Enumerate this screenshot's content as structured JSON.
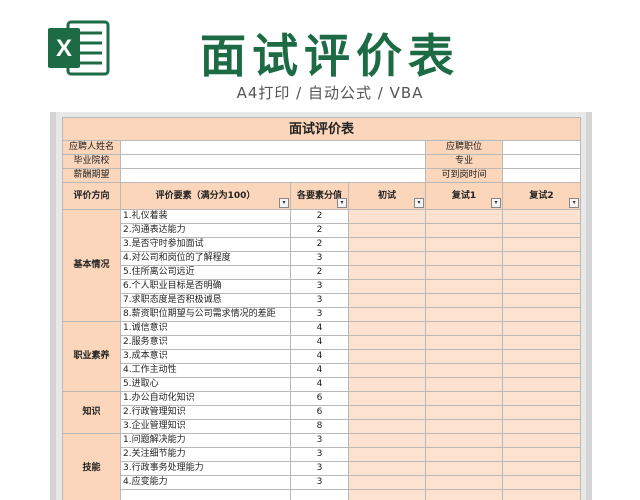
{
  "header": {
    "title": "面试评价表",
    "subtitle": "A4打印 / 自动公式 / VBA",
    "logo_icon": "excel-logo-icon",
    "logo_letter": "X",
    "accent": "#1c6b45"
  },
  "sheet": {
    "title": "面试评价表",
    "info_rows": [
      {
        "label1": "应聘人姓名",
        "label2": "应聘职位"
      },
      {
        "label1": "毕业院校",
        "label2": "专业"
      },
      {
        "label1": "薪酬期望",
        "label2": "可到岗时间"
      }
    ],
    "columns": [
      "评价方向",
      "评价要素（满分为100）",
      "各要素分值",
      "初试",
      "复试1",
      "复试2"
    ],
    "dropdown_glyph": "▾",
    "categories": [
      {
        "name": "基本情况",
        "items": [
          {
            "text": "1.礼仪着装",
            "score": "2"
          },
          {
            "text": "2.沟通表达能力",
            "score": "2"
          },
          {
            "text": "3.是否守时参加面试",
            "score": "2"
          },
          {
            "text": "4.对公司和岗位的了解程度",
            "score": "3"
          },
          {
            "text": "5.住所离公司远近",
            "score": "2"
          },
          {
            "text": "6.个人职业目标是否明确",
            "score": "3"
          },
          {
            "text": "7.求职态度是否积极诚恳",
            "score": "3"
          },
          {
            "text": "8.薪资职位期望与公司需求情况的差距",
            "score": "3"
          }
        ]
      },
      {
        "name": "职业素养",
        "items": [
          {
            "text": "1.诚信意识",
            "score": "4"
          },
          {
            "text": "2.服务意识",
            "score": "4"
          },
          {
            "text": "3.成本意识",
            "score": "4"
          },
          {
            "text": "4.工作主动性",
            "score": "4"
          },
          {
            "text": "5.进取心",
            "score": "4"
          }
        ]
      },
      {
        "name": "知识",
        "items": [
          {
            "text": "1.办公自动化知识",
            "score": "6"
          },
          {
            "text": "2.行政管理知识",
            "score": "6"
          },
          {
            "text": "3.企业管理知识",
            "score": "8"
          }
        ]
      },
      {
        "name": "技能",
        "items": [
          {
            "text": "1.问题解决能力",
            "score": "3"
          },
          {
            "text": "2.关注细节能力",
            "score": "3"
          },
          {
            "text": "3.行政事务处理能力",
            "score": "3"
          },
          {
            "text": "4.应变能力",
            "score": "3"
          },
          {
            "text": "",
            "score": ""
          }
        ]
      }
    ]
  }
}
